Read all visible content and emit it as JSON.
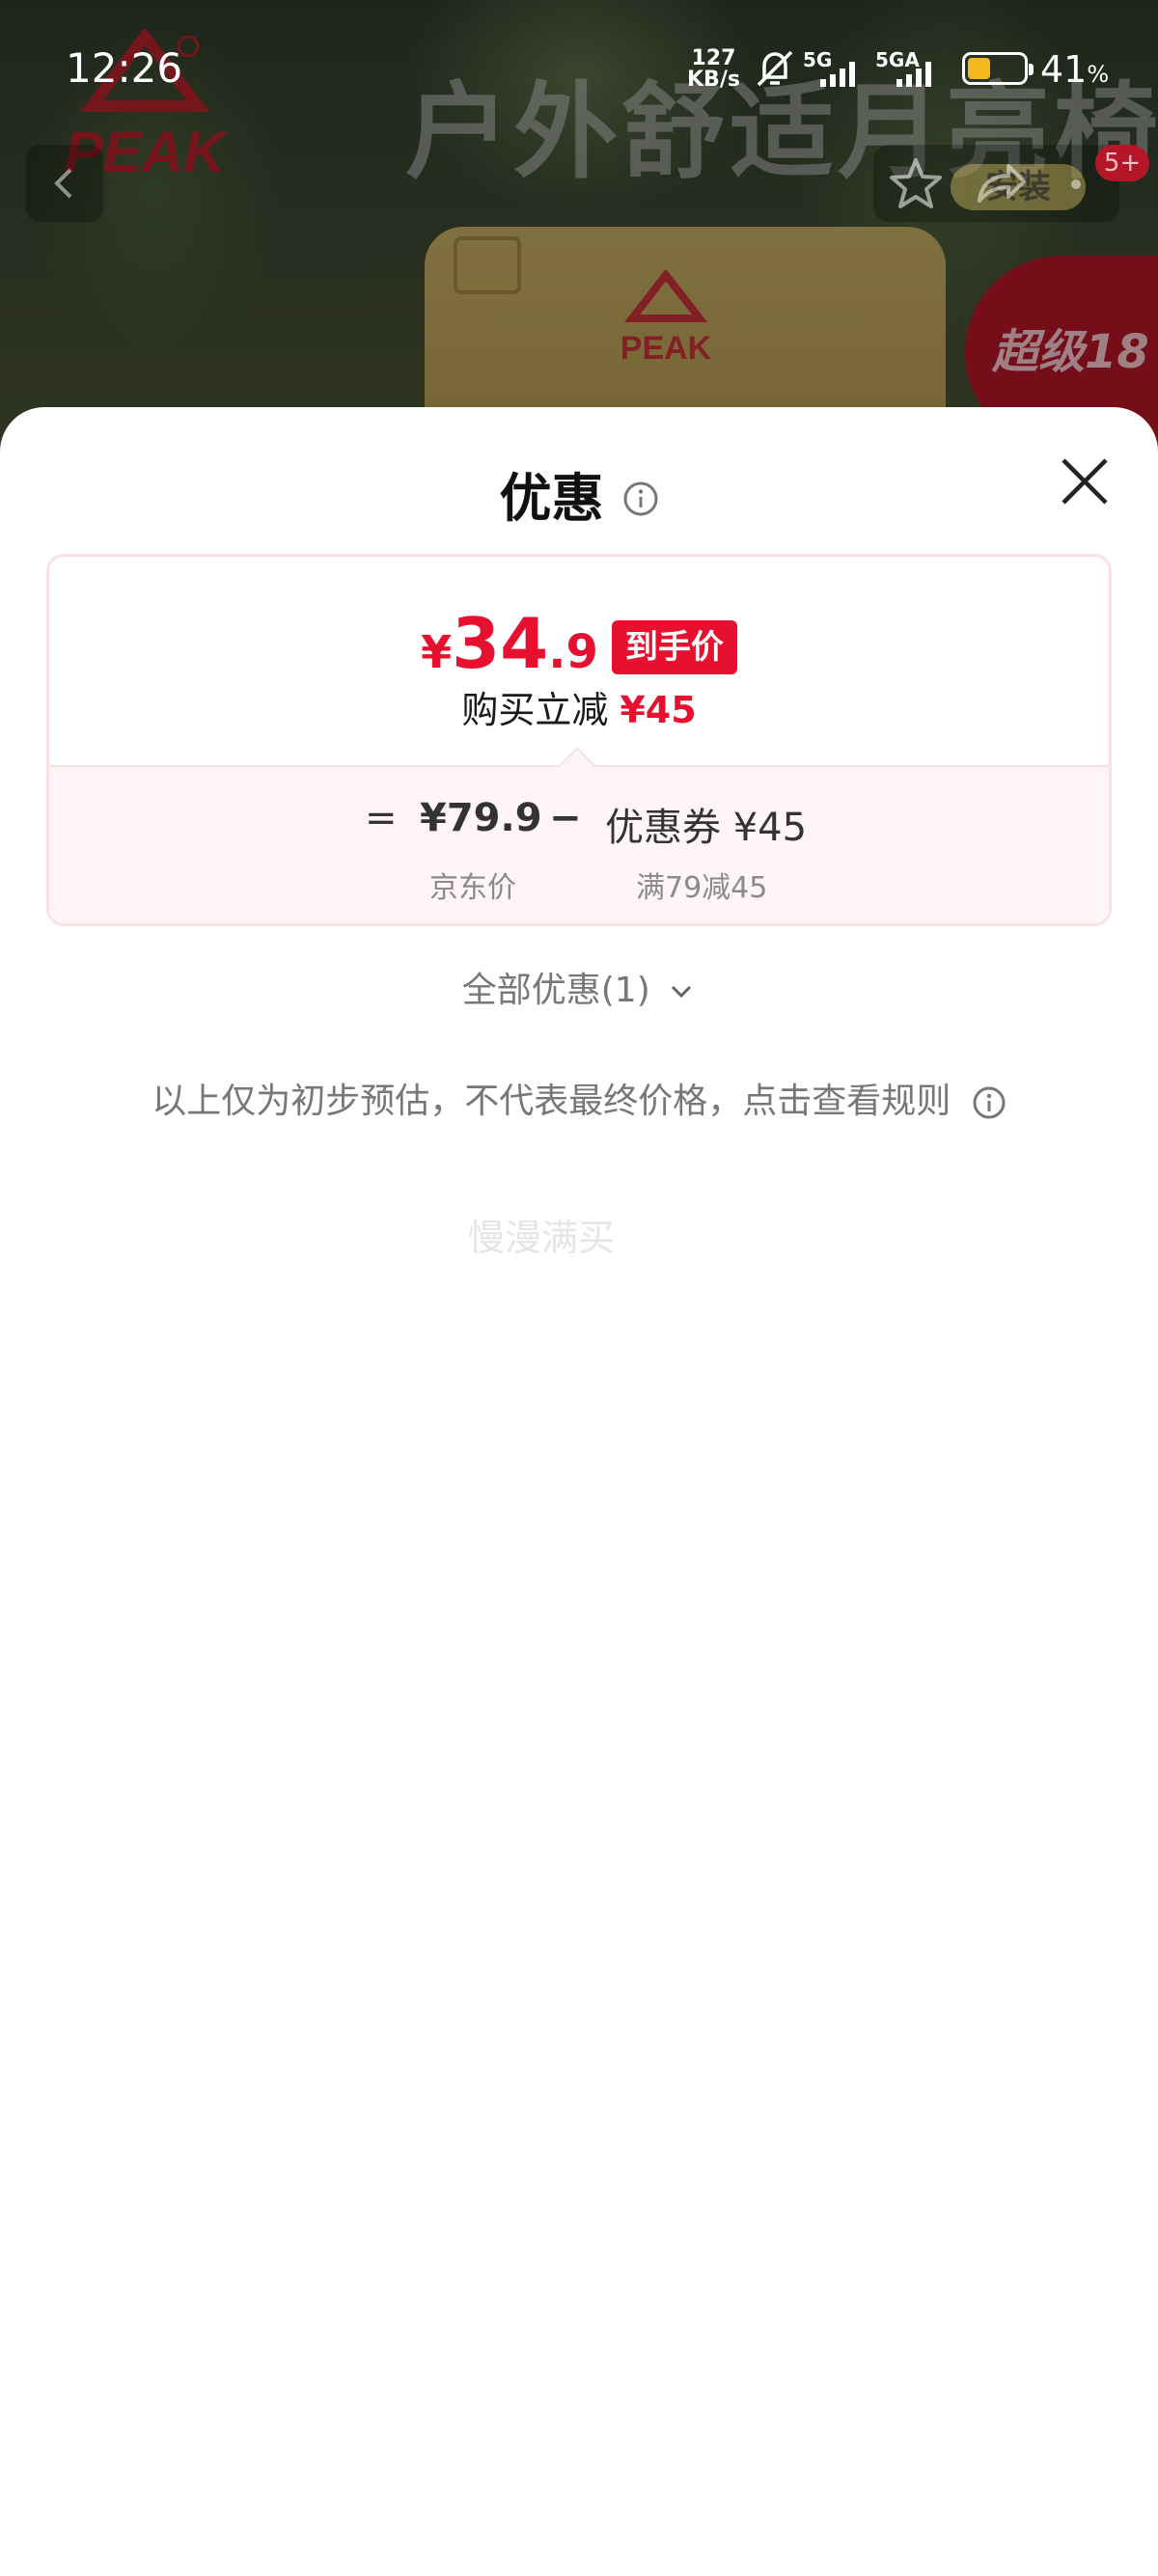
{
  "status_bar": {
    "time": "12:26",
    "net_speed_value": "127",
    "net_speed_unit": "KB/s",
    "signal1_label": "5G",
    "signal2_label": "5GA",
    "battery_percent": "41",
    "battery_percent_sign": "%",
    "battery_level": 0.41
  },
  "background": {
    "brand_logo_text": "PEAK",
    "headline": "户外舒适月亮椅",
    "promo_badge": "超级18",
    "install_label": "安装",
    "notification_count": "5+",
    "back_icon": "chevron-left-icon",
    "star_icon": "star-icon",
    "share_icon": "share-icon"
  },
  "sheet": {
    "title": "优惠",
    "price": {
      "currency": "¥",
      "integer": "34",
      "decimal": ".9",
      "tag": "到手价",
      "saving_label": "购买立减",
      "saving_amount": "¥45"
    },
    "formula": {
      "equals": "=",
      "base_price": "¥79.9",
      "minus": "−",
      "coupon": "优惠券 ¥45",
      "base_label": "京东价",
      "coupon_label": "满79减45"
    },
    "all_offers": "全部优惠(1)",
    "disclaimer": "以上仅为初步预估，不代表最终价格，点击查看规则",
    "ghost_text": "慢漫满买"
  },
  "colors": {
    "accent_red": "#e8102f",
    "card_border": "#fbe1e5",
    "card_bottom_bg": "#fff5f7",
    "badge_red": "#b51628"
  }
}
